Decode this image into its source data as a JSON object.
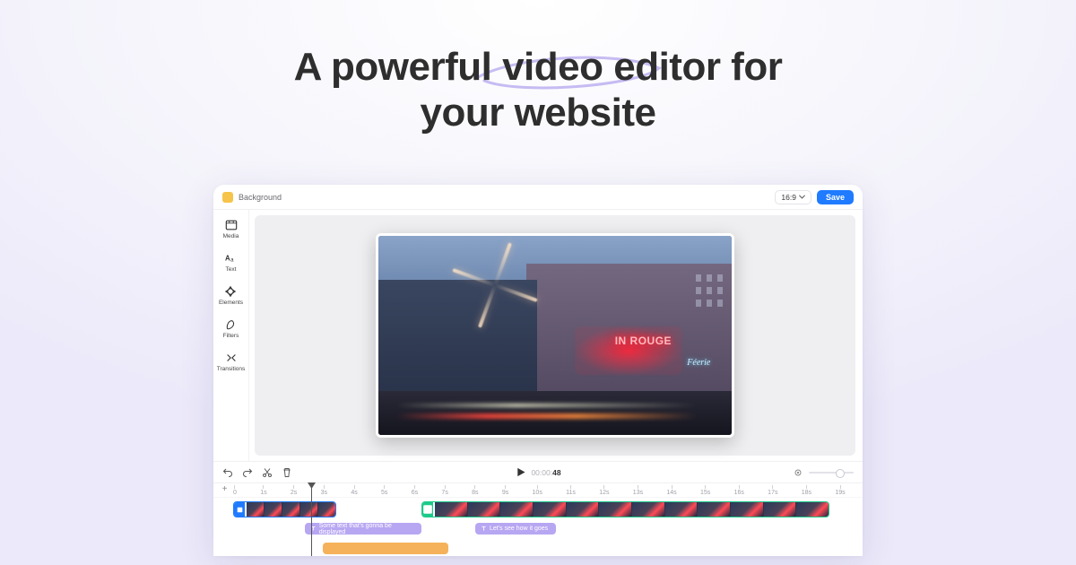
{
  "hero": {
    "title_line1": "A powerful video editor for",
    "title_line2": "your website"
  },
  "topbar": {
    "background_label": "Background",
    "aspect_ratio": "16:9",
    "save_label": "Save"
  },
  "sidebar": {
    "items": [
      {
        "label": "Media"
      },
      {
        "label": "Text"
      },
      {
        "label": "Elements"
      },
      {
        "label": "Filters"
      },
      {
        "label": "Transitions"
      }
    ]
  },
  "preview": {
    "neon_sign": "IN ROUGE",
    "feerie_sign": "Féerie"
  },
  "playbar": {
    "current_time": "00:00:",
    "total_time": "48"
  },
  "ruler": {
    "ticks": [
      "0",
      "1s",
      "2s",
      "3s",
      "4s",
      "5s",
      "6s",
      "7s",
      "8s",
      "9s",
      "10s",
      "11s",
      "12s",
      "13s",
      "14s",
      "15s",
      "16s",
      "17s",
      "18s",
      "19s"
    ]
  },
  "timeline": {
    "text_clip_1": "Some text that's gonna be displayed",
    "text_clip_2": "Let's see how it goes"
  }
}
